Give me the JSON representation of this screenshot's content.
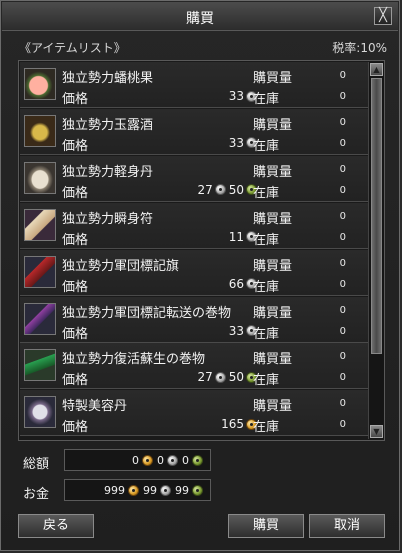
{
  "window": {
    "title": "購買",
    "close_glyph": "╳"
  },
  "header": {
    "list_label": "《アイテムリスト》",
    "tax_label": "税率:10%"
  },
  "labels": {
    "price": "価格",
    "quantity": "購買量",
    "stock": "在庫"
  },
  "items": [
    {
      "name": "独立勢力蟠桃果",
      "icon": "peach-icon",
      "price_a": "",
      "price_b": "33",
      "price_c": "",
      "qty": "0",
      "stock": "0"
    },
    {
      "name": "独立勢力玉露酒",
      "icon": "wine-jug-icon",
      "price_a": "",
      "price_b": "33",
      "price_c": "",
      "qty": "0",
      "stock": "0"
    },
    {
      "name": "独立勢力軽身丹",
      "icon": "pill-icon",
      "price_a": "",
      "price_b": "27",
      "price_c": "50",
      "qty": "0",
      "stock": "0"
    },
    {
      "name": "独立勢力瞬身符",
      "icon": "talisman-icon",
      "price_a": "",
      "price_b": "11",
      "price_c": "",
      "qty": "0",
      "stock": "0"
    },
    {
      "name": "独立勢力軍団標記旗",
      "icon": "banner-icon",
      "price_a": "",
      "price_b": "66",
      "price_c": "",
      "qty": "0",
      "stock": "0"
    },
    {
      "name": "独立勢力軍団標記転送の巻物",
      "icon": "scroll-icon",
      "price_a": "",
      "price_b": "33",
      "price_c": "",
      "qty": "0",
      "stock": "0"
    },
    {
      "name": "独立勢力復活蘇生の巻物",
      "icon": "revive-scroll-icon",
      "price_a": "",
      "price_b": "27",
      "price_c": "50",
      "qty": "0",
      "stock": "0"
    },
    {
      "name": "特製美容丹",
      "icon": "beauty-pill-icon",
      "price_a": "165",
      "price_b": "",
      "price_c": "",
      "qty": "0",
      "stock": "0"
    }
  ],
  "totals": {
    "total_label": "総額",
    "total_gold": "0",
    "total_silver": "0",
    "total_bronze": "0",
    "money_label": "お金",
    "money_gold": "999",
    "money_silver": "99",
    "money_bronze": "99"
  },
  "buttons": {
    "back": "戻る",
    "buy": "購買",
    "cancel": "取消"
  }
}
